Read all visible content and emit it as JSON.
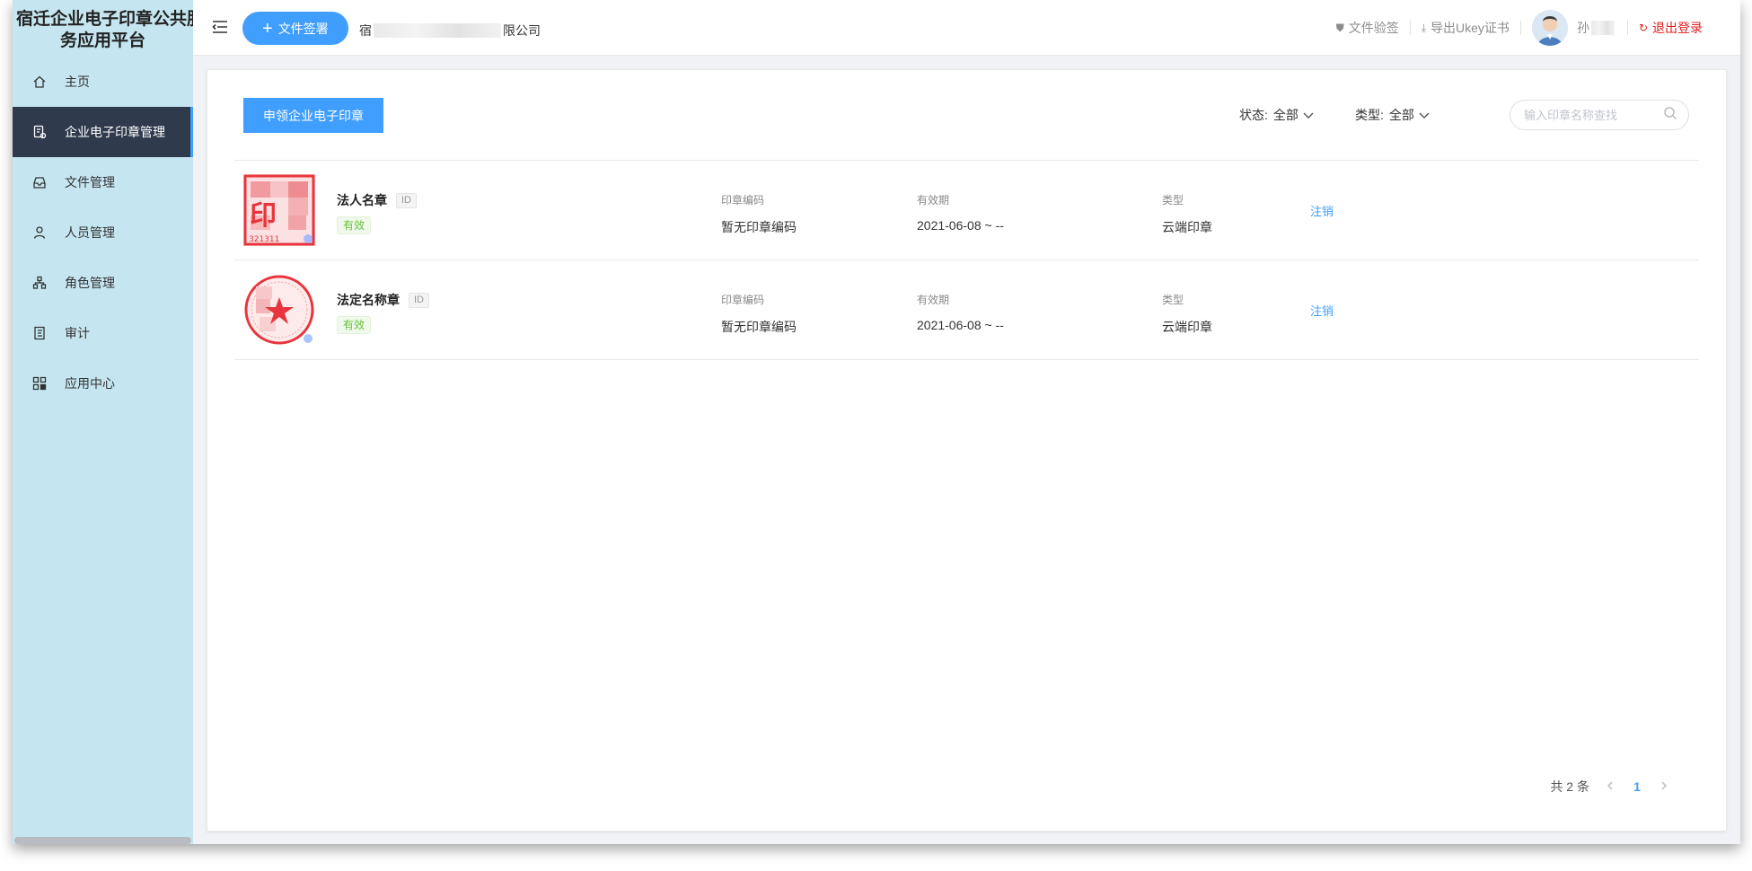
{
  "brand": {
    "line1": "宿迁企业电子印章公共服",
    "line2": "务应用平台"
  },
  "sidebar": {
    "items": [
      {
        "label": "主页",
        "icon": "home-icon"
      },
      {
        "label": "企业电子印章管理",
        "icon": "seal-manage-icon",
        "active": true
      },
      {
        "label": "文件管理",
        "icon": "file-manage-icon"
      },
      {
        "label": "人员管理",
        "icon": "user-icon"
      },
      {
        "label": "角色管理",
        "icon": "role-icon"
      },
      {
        "label": "审计",
        "icon": "audit-icon"
      },
      {
        "label": "应用中心",
        "icon": "apps-icon"
      }
    ]
  },
  "header": {
    "sign_button": "文件签署",
    "company_prefix": "宿",
    "company_suffix": "限公司",
    "verify": "文件验签",
    "export_ukey": "导出Ukey证书",
    "user_name": "孙",
    "logout": "退出登录"
  },
  "toolbar": {
    "apply_button": "申领企业电子印章",
    "status_label": "状态:",
    "status_value": "全部",
    "type_label": "类型:",
    "type_value": "全部",
    "search_placeholder": "输入印章名称查找"
  },
  "columns": {
    "code": "印章编码",
    "validity": "有效期",
    "type": "类型"
  },
  "seals": [
    {
      "name": "法人名章",
      "id_tag": "ID",
      "status": "有效",
      "code": "暂无印章编码",
      "validity": "2021-06-08 ~ --",
      "type": "云端印章",
      "action": "注销",
      "seal_text": "印",
      "seal_number": "321311"
    },
    {
      "name": "法定名称章",
      "id_tag": "ID",
      "status": "有效",
      "code": "暂无印章编码",
      "validity": "2021-06-08 ~ --",
      "type": "云端印章",
      "action": "注销"
    }
  ],
  "pagination": {
    "total_text": "共 2 条",
    "current_page": "1"
  },
  "colors": {
    "primary": "#409eff",
    "sidebar_bg": "#c5e6f0",
    "active_bg": "#2f3b4d",
    "danger": "#e02020",
    "success": "#67c23a",
    "seal_red": "#e8353d"
  }
}
